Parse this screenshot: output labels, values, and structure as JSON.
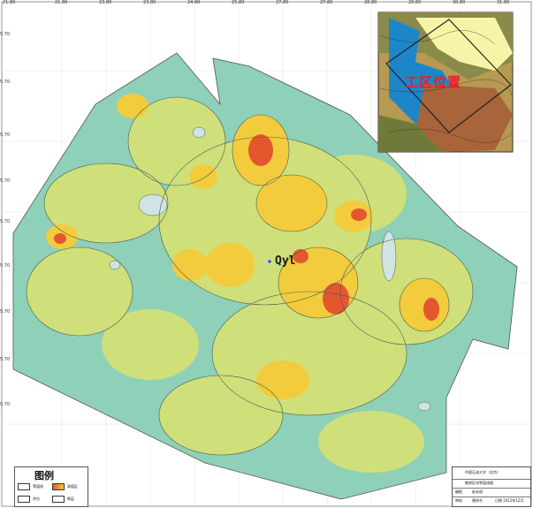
{
  "map": {
    "well_label": "Qyl",
    "inset_label": "工区位置",
    "top_ticks": [
      "21.80",
      "21.80",
      "23.80",
      "23.80",
      "24.80",
      "25.80",
      "27.80",
      "27.80",
      "28.80",
      "29.80",
      "30.80",
      "31.80"
    ],
    "left_ticks": [
      "5.70",
      "5.70",
      "5.70",
      "5.70",
      "5.70",
      "5.70",
      "5.70",
      "5.70",
      "5.70"
    ],
    "colors": {
      "low": "#8fd0b8",
      "mid": "#cfe07a",
      "high": "#f2cc3c",
      "peak": "#e4572e",
      "void": "#cfe4e3",
      "contour": "#4a5a55"
    }
  },
  "legend": {
    "title": "图例",
    "items": [
      {
        "label": "等值线",
        "swatch": "contour-icon"
      },
      {
        "label": "高值区",
        "swatch": "high-value-icon"
      },
      {
        "label": "井位",
        "swatch": "well-icon"
      },
      {
        "label": "断层",
        "swatch": "fault-icon"
      }
    ]
  },
  "title_block": {
    "org": "中国石油大学（北京）",
    "map_title": "勘探区块等值线图",
    "drawn_by_label": "编图",
    "drawn_by": "赵永斌",
    "checked_by_label": "审核",
    "checked_by": "黄梓东",
    "date": "日期 2012年12月"
  }
}
